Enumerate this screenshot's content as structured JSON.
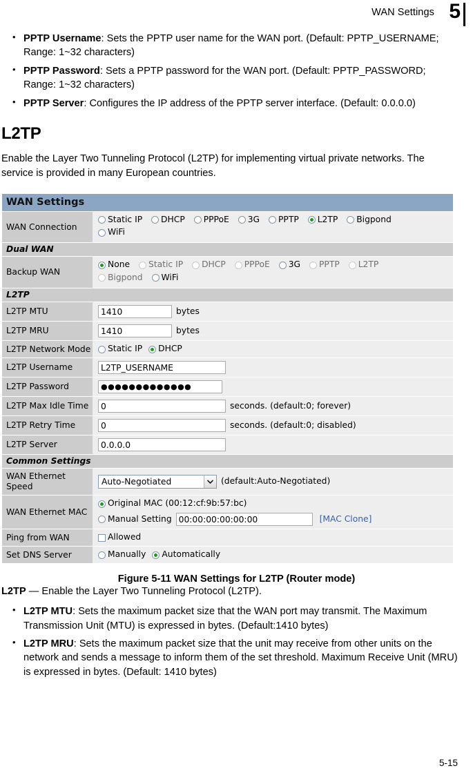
{
  "header": {
    "title": "WAN Settings",
    "chapter": "5"
  },
  "intro_bullets": [
    {
      "term": "PPTP Username",
      "text": ": Sets the PPTP user name for the WAN port. (Default: PPTP_USERNAME; Range: 1~32 characters)"
    },
    {
      "term": "PPTP Password",
      "text": ": Sets a PPTP password for the WAN port. (Default: PPTP_PASSWORD; Range: 1~32 characters)"
    },
    {
      "term": "PPTP Server",
      "text": ": Configures the IP address of the PPTP server interface.  (Default: 0.0.0.0)"
    }
  ],
  "section": {
    "heading": "L2TP",
    "paragraph": "Enable the Layer Two Tunneling Protocol (L2TP) for implementing virtual private networks. The service is provided in many European countries."
  },
  "figure": {
    "panel_title": "WAN Settings",
    "rows": {
      "wan_connection": {
        "label": "WAN Connection",
        "options_line1": [
          "Static IP",
          "DHCP",
          "PPPoE",
          "3G",
          "PPTP",
          "L2TP",
          "Bigpond"
        ],
        "options_line2": [
          "WiFi"
        ],
        "selected": "L2TP"
      },
      "dual_wan_bar": "Dual WAN",
      "backup_wan": {
        "label": "Backup WAN",
        "options_line1": [
          "None",
          "Static IP",
          "DHCP",
          "PPPoE",
          "3G",
          "PPTP",
          "L2TP"
        ],
        "options_line2": [
          "Bigpond",
          "WiFi"
        ],
        "selected": "None"
      },
      "l2tp_bar": "L2TP",
      "l2tp_mtu": {
        "label": "L2TP MTU",
        "value": "1410",
        "unit": "bytes"
      },
      "l2tp_mru": {
        "label": "L2TP MRU",
        "value": "1410",
        "unit": "bytes"
      },
      "l2tp_network_mode": {
        "label": "L2TP Network Mode",
        "options": [
          "Static IP",
          "DHCP"
        ],
        "selected": "DHCP"
      },
      "l2tp_username": {
        "label": "L2TP Username",
        "value": "L2TP_USERNAME"
      },
      "l2tp_password": {
        "label": "L2TP Password",
        "value": "●●●●●●●●●●●●●"
      },
      "l2tp_max_idle_time": {
        "label": "L2TP Max Idle Time",
        "value": "0",
        "unit": "seconds. (default:0; forever)"
      },
      "l2tp_retry_time": {
        "label": "L2TP Retry Time",
        "value": "0",
        "unit": "seconds. (default:0; disabled)"
      },
      "l2tp_server": {
        "label": "L2TP Server",
        "value": "0.0.0.0"
      },
      "common_settings_bar": "Common Settings",
      "wan_ethernet_speed": {
        "label": "WAN Ethernet Speed",
        "value": "Auto-Negotiated",
        "hint": "(default:Auto-Negotiated)"
      },
      "wan_ethernet_mac": {
        "label": "WAN Ethernet MAC",
        "original_label": "Original MAC (00:12:cf:9b:57:bc)",
        "manual_label": "Manual Setting",
        "manual_value": "00:00:00:00:00:00",
        "clone_link": "[MAC Clone]",
        "selected": "Original MAC"
      },
      "ping_from_wan": {
        "label": "Ping from WAN",
        "option": "Allowed",
        "checked": false
      },
      "set_dns_server": {
        "label": "Set DNS Server",
        "options": [
          "Manually",
          "Automatically"
        ],
        "selected": "Automatically"
      }
    }
  },
  "caption": "Figure 5-11  WAN Settings for L2TP (Router mode)",
  "after_figure": {
    "lead_term": "L2TP",
    "lead_text": " — Enable the Layer Two Tunneling Protocol (L2TP).",
    "bullets": [
      {
        "term": "L2TP MTU",
        "text": ": Sets the maximum packet size that the WAN port may transmit. The Maximum Transmission Unit (MTU) is expressed in bytes. (Default:1410 bytes)"
      },
      {
        "term": "L2TP MRU",
        "text": ": Sets the maximum packet size that the unit may receive from other units on the network and sends a message to inform them of the set threshold. Maximum Receive Unit (MRU) is expressed in bytes. (Default: 1410 bytes)"
      }
    ]
  },
  "page_number": "5-15"
}
